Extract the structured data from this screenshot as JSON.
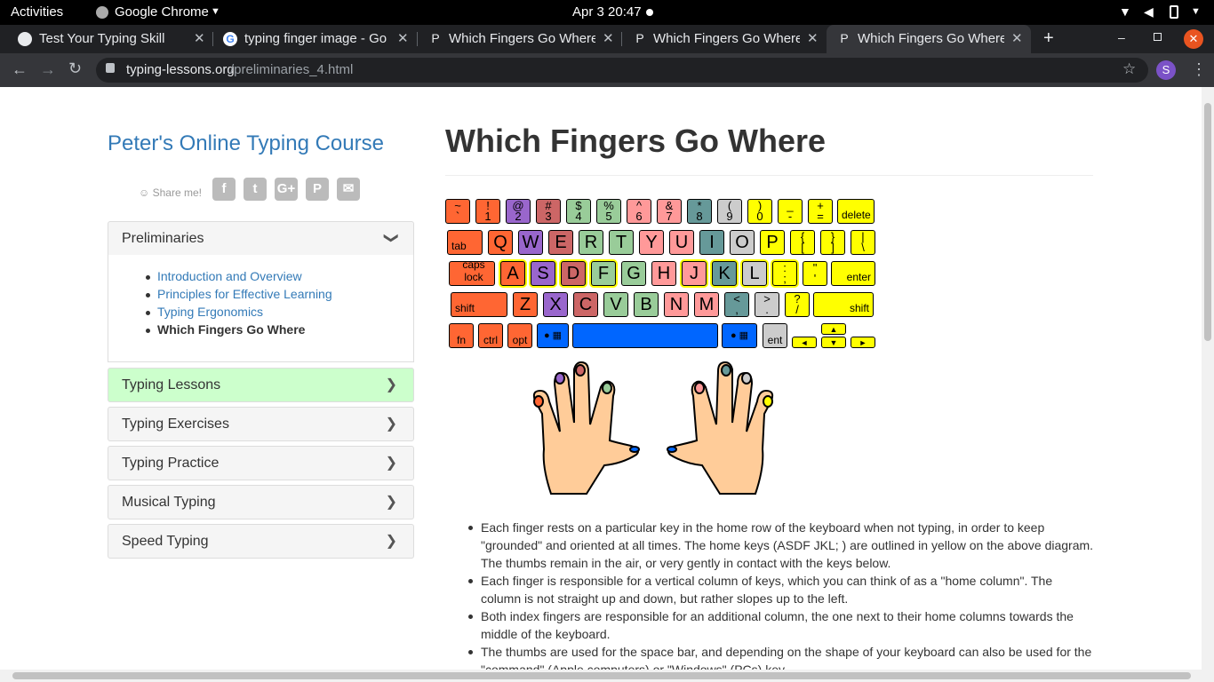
{
  "system_bar": {
    "activities": "Activities",
    "app_name": "Google Chrome",
    "datetime": "Apr 3  20:47"
  },
  "tabs": [
    {
      "title": "Test Your Typing Skill",
      "icon": "tab-favicon-icon"
    },
    {
      "title": "typing finger image - Go",
      "icon": "google-g-icon"
    },
    {
      "title": "Which Fingers Go Where",
      "icon": "tab-favicon-icon"
    },
    {
      "title": "Which Fingers Go Where",
      "icon": "tab-favicon-icon"
    },
    {
      "title": "Which Fingers Go Where",
      "icon": "tab-favicon-icon"
    }
  ],
  "address": {
    "domain": "typing-lessons.org",
    "path": "/preliminaries_4.html"
  },
  "profile_initial": "S",
  "site": {
    "title": "Peter's Online Typing Course",
    "share_label": "Share me!"
  },
  "share_icons": [
    "f",
    "t",
    "G+",
    "P",
    "✉"
  ],
  "sidebar": {
    "preliminaries": {
      "label": "Preliminaries",
      "items": [
        "Introduction and Overview",
        "Principles for Effective Learning",
        "Typing Ergonomics",
        "Which Fingers Go Where"
      ]
    },
    "sections": [
      "Typing Lessons",
      "Typing Exercises",
      "Typing Practice",
      "Musical Typing",
      "Speed Typing"
    ]
  },
  "page_title": "Which Fingers Go Where",
  "keyboard": {
    "colors": {
      "orange": "#ff6633",
      "red": "#cc6666",
      "purple": "#9966cc",
      "green": "#99cc99",
      "pink": "#ff9999",
      "teal": "#669999",
      "grey": "#cccccc",
      "yellow": "#ffff00",
      "blue": "#0066ff"
    },
    "row1": [
      {
        "t": "~",
        "b": "`",
        "c": "orange"
      },
      {
        "t": "!",
        "b": "1",
        "c": "orange"
      },
      {
        "t": "@",
        "b": "2",
        "c": "purple"
      },
      {
        "t": "#",
        "b": "3",
        "c": "red"
      },
      {
        "t": "$",
        "b": "4",
        "c": "green"
      },
      {
        "t": "%",
        "b": "5",
        "c": "green"
      },
      {
        "t": "^",
        "b": "6",
        "c": "pink"
      },
      {
        "t": "&",
        "b": "7",
        "c": "pink"
      },
      {
        "t": "*",
        "b": "8",
        "c": "teal"
      },
      {
        "t": "(",
        "b": "9",
        "c": "grey"
      },
      {
        "t": ")",
        "b": "0",
        "c": "yellow"
      },
      {
        "t": "_",
        "b": "-",
        "c": "yellow"
      },
      {
        "t": "+",
        "b": "=",
        "c": "yellow"
      },
      {
        "w": "delete",
        "c": "yellow"
      }
    ],
    "row2": [
      {
        "w": "tab",
        "c": "orange"
      },
      {
        "k": "Q",
        "c": "orange"
      },
      {
        "k": "W",
        "c": "purple"
      },
      {
        "k": "E",
        "c": "red"
      },
      {
        "k": "R",
        "c": "green"
      },
      {
        "k": "T",
        "c": "green"
      },
      {
        "k": "Y",
        "c": "pink"
      },
      {
        "k": "U",
        "c": "pink"
      },
      {
        "k": "I",
        "c": "teal"
      },
      {
        "k": "O",
        "c": "grey"
      },
      {
        "k": "P",
        "c": "yellow"
      },
      {
        "t": "{",
        "b": "[",
        "c": "yellow"
      },
      {
        "t": "}",
        "b": "]",
        "c": "yellow"
      },
      {
        "t": "|",
        "b": "\\",
        "c": "yellow"
      }
    ],
    "row3": [
      {
        "w": "caps lock",
        "c": "orange"
      },
      {
        "k": "A",
        "c": "orange",
        "home": true
      },
      {
        "k": "S",
        "c": "purple",
        "home": true
      },
      {
        "k": "D",
        "c": "red",
        "home": true
      },
      {
        "k": "F",
        "c": "green",
        "home": true
      },
      {
        "k": "G",
        "c": "green"
      },
      {
        "k": "H",
        "c": "pink"
      },
      {
        "k": "J",
        "c": "pink",
        "home": true
      },
      {
        "k": "K",
        "c": "teal",
        "home": true
      },
      {
        "k": "L",
        "c": "grey",
        "home": true
      },
      {
        "t": ":",
        "b": ";",
        "c": "yellow",
        "home": true
      },
      {
        "t": "\"",
        "b": "'",
        "c": "yellow"
      },
      {
        "wr": "enter",
        "c": "yellow"
      }
    ],
    "row4": [
      {
        "w": "shift",
        "c": "orange"
      },
      {
        "k": "Z",
        "c": "orange"
      },
      {
        "k": "X",
        "c": "purple"
      },
      {
        "k": "C",
        "c": "red"
      },
      {
        "k": "V",
        "c": "green"
      },
      {
        "k": "B",
        "c": "green"
      },
      {
        "k": "N",
        "c": "pink"
      },
      {
        "k": "M",
        "c": "pink"
      },
      {
        "t": "<",
        "b": ",",
        "c": "teal"
      },
      {
        "t": ">",
        "b": ".",
        "c": "grey"
      },
      {
        "t": "?",
        "b": "/",
        "c": "yellow"
      },
      {
        "wr": "shift",
        "c": "yellow"
      }
    ],
    "row5": [
      {
        "k": "fn",
        "c": "orange"
      },
      {
        "k": "ctrl",
        "c": "orange"
      },
      {
        "k": "opt",
        "c": "orange"
      },
      {
        "k": "cmd",
        "c": "blue"
      },
      {
        "k": "space",
        "c": "blue"
      },
      {
        "k": "cmd",
        "c": "blue"
      },
      {
        "k": "ent",
        "c": "grey"
      }
    ],
    "arrows": [
      "▲",
      "◄",
      "▼",
      "►"
    ]
  },
  "bullets": [
    "Each finger rests on a particular key in the home row of the keyboard when not typing, in order to keep \"grounded\" and oriented at all times. The home keys (ASDF JKL; ) are outlined in yellow on the above diagram. The thumbs remain in the air, or very gently in contact with the keys below.",
    "Each finger is responsible for a vertical column of keys, which you can think of as a \"home column\". The column is not straight up and down, but rather slopes up to the left.",
    "Both index fingers are responsible for an additional column, the one next to their home columns towards the middle of the keyboard.",
    "The thumbs are used for the space bar, and depending on the shape of your keyboard can also be used for the \"command\" (Apple computers) or \"Windows\" (PCs) key."
  ]
}
